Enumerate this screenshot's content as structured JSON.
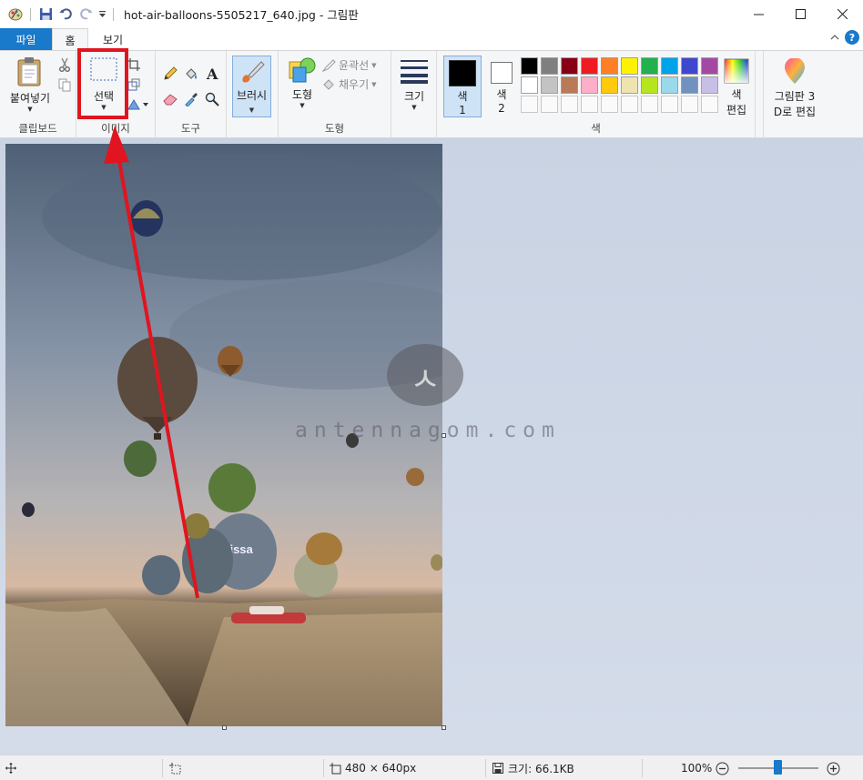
{
  "window": {
    "title": "hot-air-balloons-5505217_640.jpg - 그림판"
  },
  "tabs": [
    {
      "label": "파일"
    },
    {
      "label": "홈"
    },
    {
      "label": "보기"
    }
  ],
  "ribbon": {
    "clipboard": {
      "paste_label": "붙여넣기",
      "group_label": "클립보드"
    },
    "image": {
      "select_label": "선택",
      "group_label": "이미지"
    },
    "tools": {
      "group_label": "도구"
    },
    "brushes": {
      "label": "브러시"
    },
    "shapes": {
      "shape_label": "도형",
      "outline_label": "윤곽선",
      "fill_label": "채우기",
      "group_label": "도형"
    },
    "size": {
      "label": "크기"
    },
    "colors": {
      "color1_label_a": "색",
      "color1_label_b": "1",
      "color2_label_a": "색",
      "color2_label_b": "2",
      "edit_label_a": "색",
      "edit_label_b": "편집",
      "group_label": "색",
      "color1_value": "#000000",
      "color2_value": "#ffffff",
      "palette_row1": [
        "#000000",
        "#7f7f7f",
        "#880015",
        "#ed1c24",
        "#ff7f27",
        "#fff200",
        "#22b14c",
        "#00a2e8",
        "#3f48cc",
        "#a349a4"
      ],
      "palette_row2": [
        "#ffffff",
        "#c3c3c3",
        "#b97a57",
        "#ffaec9",
        "#ffc90e",
        "#efe4b0",
        "#b5e61d",
        "#99d9ea",
        "#7092be",
        "#c8bfe7"
      ]
    },
    "paint3d": {
      "label_a": "그림판 3",
      "label_b": "D로 편집"
    }
  },
  "watermark": {
    "text": "antennagom.com"
  },
  "status": {
    "dimensions": "480 × 640px",
    "size": "크기: 66.1KB",
    "zoom": "100%"
  },
  "colors": {
    "accent": "#1979ca",
    "highlight_box": "#e0151f"
  }
}
